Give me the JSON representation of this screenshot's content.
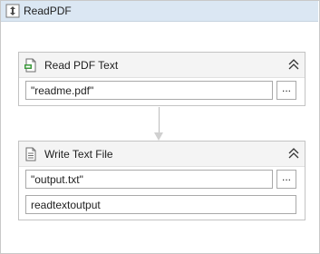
{
  "sequence": {
    "title": "ReadPDF"
  },
  "activities": {
    "read_pdf": {
      "title": "Read PDF Text",
      "file_value": "\"readme.pdf\"",
      "browse_label": "..."
    },
    "write_file": {
      "title": "Write Text File",
      "file_value": "\"output.txt\"",
      "browse_label": "...",
      "text_value": "readtextoutput"
    }
  },
  "icons": {
    "sequence": "collapse-sequence-icon",
    "read_pdf": "pdf-document-icon",
    "write_file": "text-file-icon",
    "collapse": "double-chevron-up-icon"
  },
  "colors": {
    "sequence_header": "#dbe7f3",
    "activity_header": "#f4f4f4",
    "border": "#c3c3c3"
  }
}
